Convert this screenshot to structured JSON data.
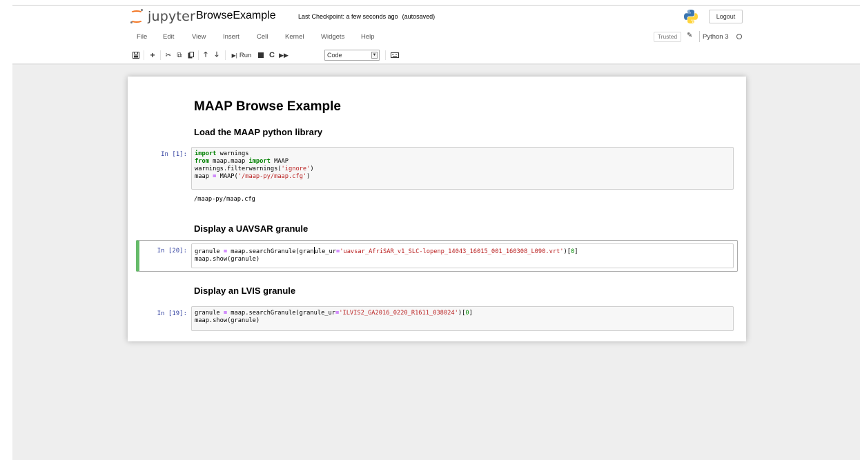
{
  "header": {
    "logo_text": "jupyter",
    "notebook_name": "BrowseExample",
    "checkpoint": "Last Checkpoint: a few seconds ago",
    "autosave": "(autosaved)",
    "logout_label": "Logout"
  },
  "menubar": {
    "items": [
      "File",
      "Edit",
      "View",
      "Insert",
      "Cell",
      "Kernel",
      "Widgets",
      "Help"
    ],
    "trusted_label": "Trusted",
    "kernel_name": "Python 3"
  },
  "toolbar": {
    "run_label": "Run",
    "cell_type": "Code"
  },
  "notebook": {
    "title": "MAAP Browse Example",
    "sections": {
      "load": "Load the MAAP python library",
      "uavsar": "Display a UAVSAR granule",
      "lvis": "Display an LVIS granule"
    },
    "cells": [
      {
        "prompt": "In [1]:",
        "output": "/maap-py/maap.cfg"
      },
      {
        "prompt": "In [20]:"
      },
      {
        "prompt": "In [19]:"
      }
    ]
  },
  "colors": {
    "accent_orange": "#f37726",
    "selected_cell_border": "#66bb6a",
    "prompt_blue": "#303f9f",
    "keyword_green": "#008000",
    "string_red": "#ba2121"
  }
}
